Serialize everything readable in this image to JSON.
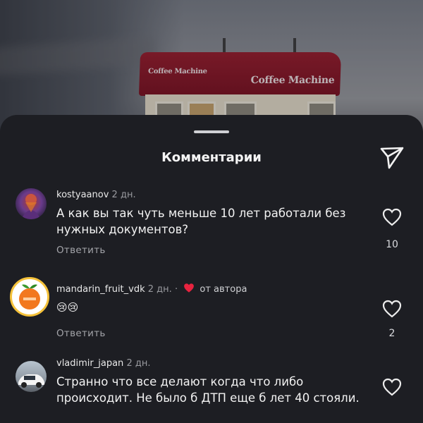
{
  "sheet": {
    "title": "Комментарии",
    "share_icon": "send-icon"
  },
  "background": {
    "kiosk_sign": "Coffee Machine"
  },
  "colors": {
    "sheet_bg": "#1d1e23",
    "accent_heart": "#e8233f"
  },
  "comments": [
    {
      "username": "kostyaanov",
      "time": "2 дн.",
      "text": "А как вы так чуть меньше 10 лет работали без нужных документов?",
      "reply_label": "Ответить",
      "likes": "10"
    },
    {
      "username": "mandarin_fruit_vdk",
      "time": "2 дн.",
      "separator": "·",
      "author_note": "от автора",
      "text": "😢😢",
      "reply_label": "Ответить",
      "likes": "2"
    },
    {
      "username": "vladimir_japan",
      "time": "2 дн.",
      "text": "Странно что все делают когда что либо происходит. Не было б ДТП еще б лет 40 стояли.",
      "reply_label": "",
      "likes": ""
    }
  ]
}
